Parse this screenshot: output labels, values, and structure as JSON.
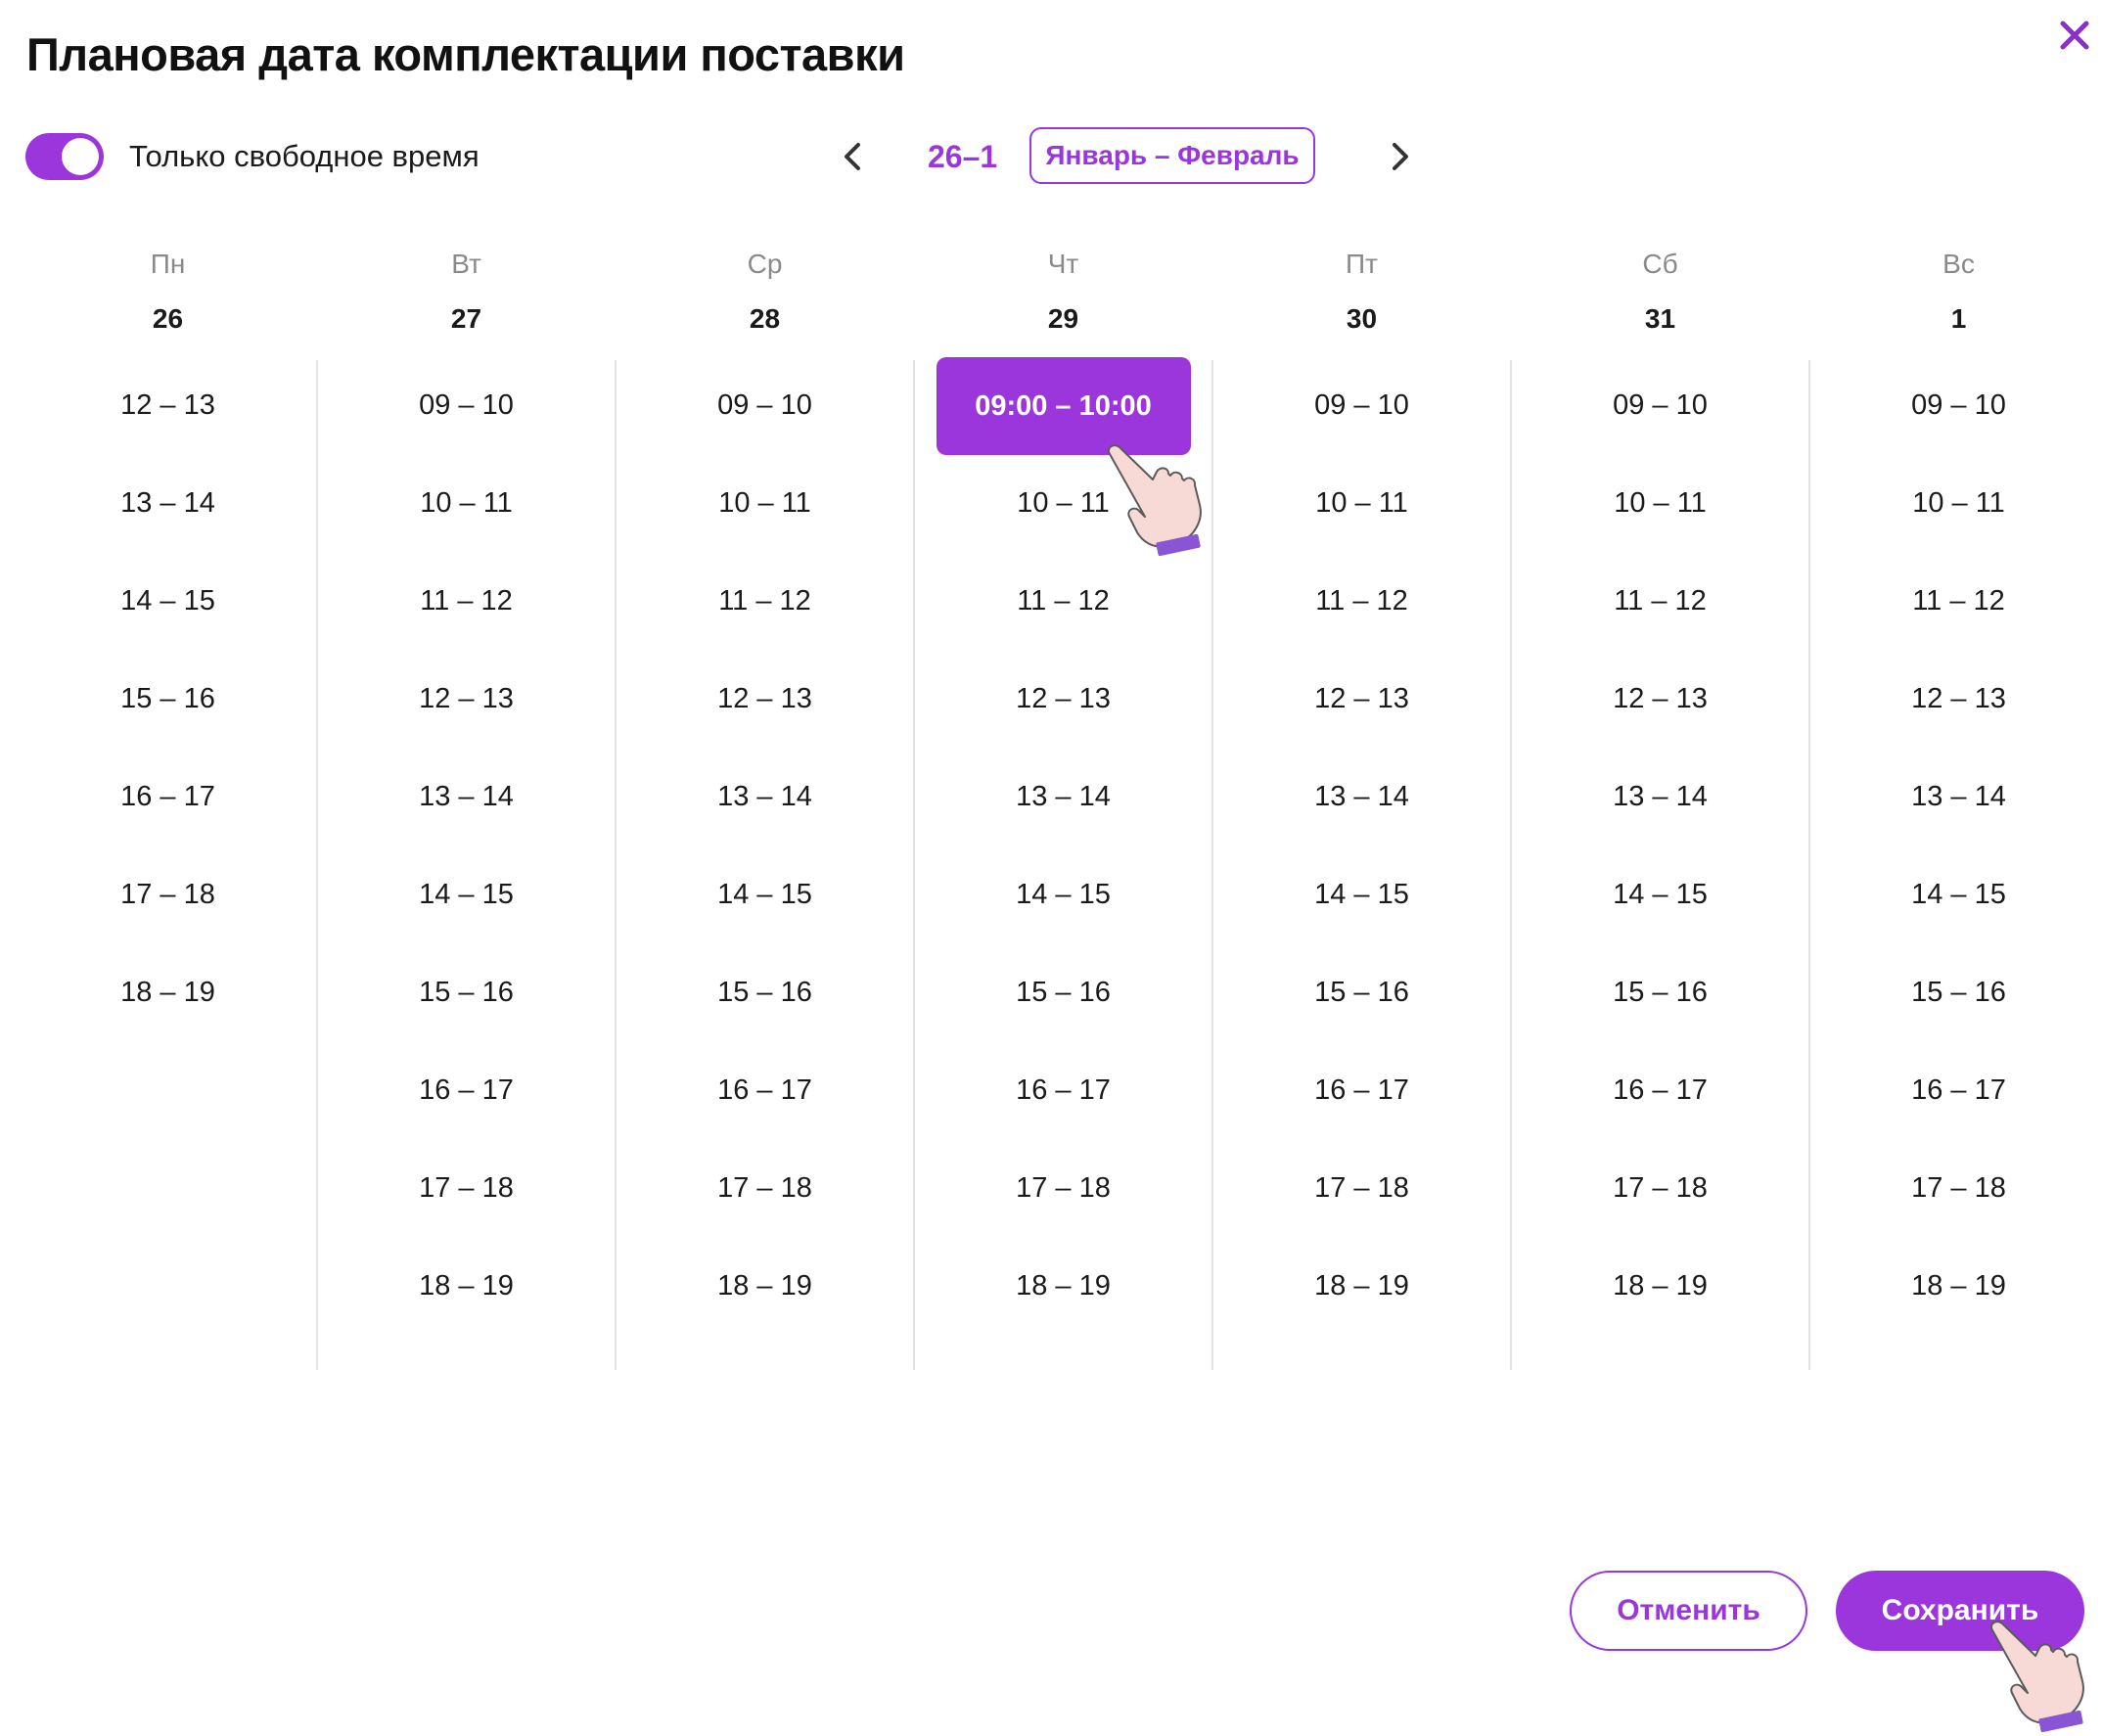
{
  "dialog": {
    "title": "Плановая дата комплектации поставки"
  },
  "filter": {
    "toggle_label": "Только свободное время",
    "toggle_on": true
  },
  "week_nav": {
    "range": "26–1",
    "month_label": "Январь – Февраль"
  },
  "days": [
    {
      "name": "Пн",
      "number": "26",
      "slots": [
        "12 – 13",
        "13 – 14",
        "14 – 15",
        "15 – 16",
        "16 – 17",
        "17 – 18",
        "18 – 19"
      ]
    },
    {
      "name": "Вт",
      "number": "27",
      "slots": [
        "09 – 10",
        "10 – 11",
        "11 – 12",
        "12 – 13",
        "13 – 14",
        "14 – 15",
        "15 – 16",
        "16 – 17",
        "17 – 18",
        "18 – 19"
      ]
    },
    {
      "name": "Ср",
      "number": "28",
      "slots": [
        "09 – 10",
        "10 – 11",
        "11 – 12",
        "12 – 13",
        "13 – 14",
        "14 – 15",
        "15 – 16",
        "16 – 17",
        "17 – 18",
        "18 – 19"
      ]
    },
    {
      "name": "Чт",
      "number": "29",
      "slots": [
        "09:00 – 10:00",
        "10 – 11",
        "11 – 12",
        "12 – 13",
        "13 – 14",
        "14 – 15",
        "15 – 16",
        "16 – 17",
        "17 – 18",
        "18 – 19"
      ],
      "selected_index": 0
    },
    {
      "name": "Пт",
      "number": "30",
      "slots": [
        "09 – 10",
        "10 – 11",
        "11 – 12",
        "12 – 13",
        "13 – 14",
        "14 – 15",
        "15 – 16",
        "16 – 17",
        "17 – 18",
        "18 – 19"
      ]
    },
    {
      "name": "Сб",
      "number": "31",
      "slots": [
        "09 – 10",
        "10 – 11",
        "11 – 12",
        "12 – 13",
        "13 – 14",
        "14 – 15",
        "15 – 16",
        "16 – 17",
        "17 – 18",
        "18 – 19"
      ]
    },
    {
      "name": "Вс",
      "number": "1",
      "slots": [
        "09 – 10",
        "10 – 11",
        "11 – 12",
        "12 – 13",
        "13 – 14",
        "14 – 15",
        "15 – 16",
        "16 – 17",
        "17 – 18",
        "18 – 19"
      ]
    }
  ],
  "footer": {
    "cancel_label": "Отменить",
    "save_label": "Сохранить"
  },
  "colors": {
    "accent": "#9a36dc",
    "divider": "#e3e3e3",
    "muted_text": "#8a8a8a"
  },
  "icons": {
    "close": "close-icon",
    "prev": "chevron-left-icon",
    "next": "chevron-right-icon",
    "cursor": "pointing-hand-icon"
  }
}
